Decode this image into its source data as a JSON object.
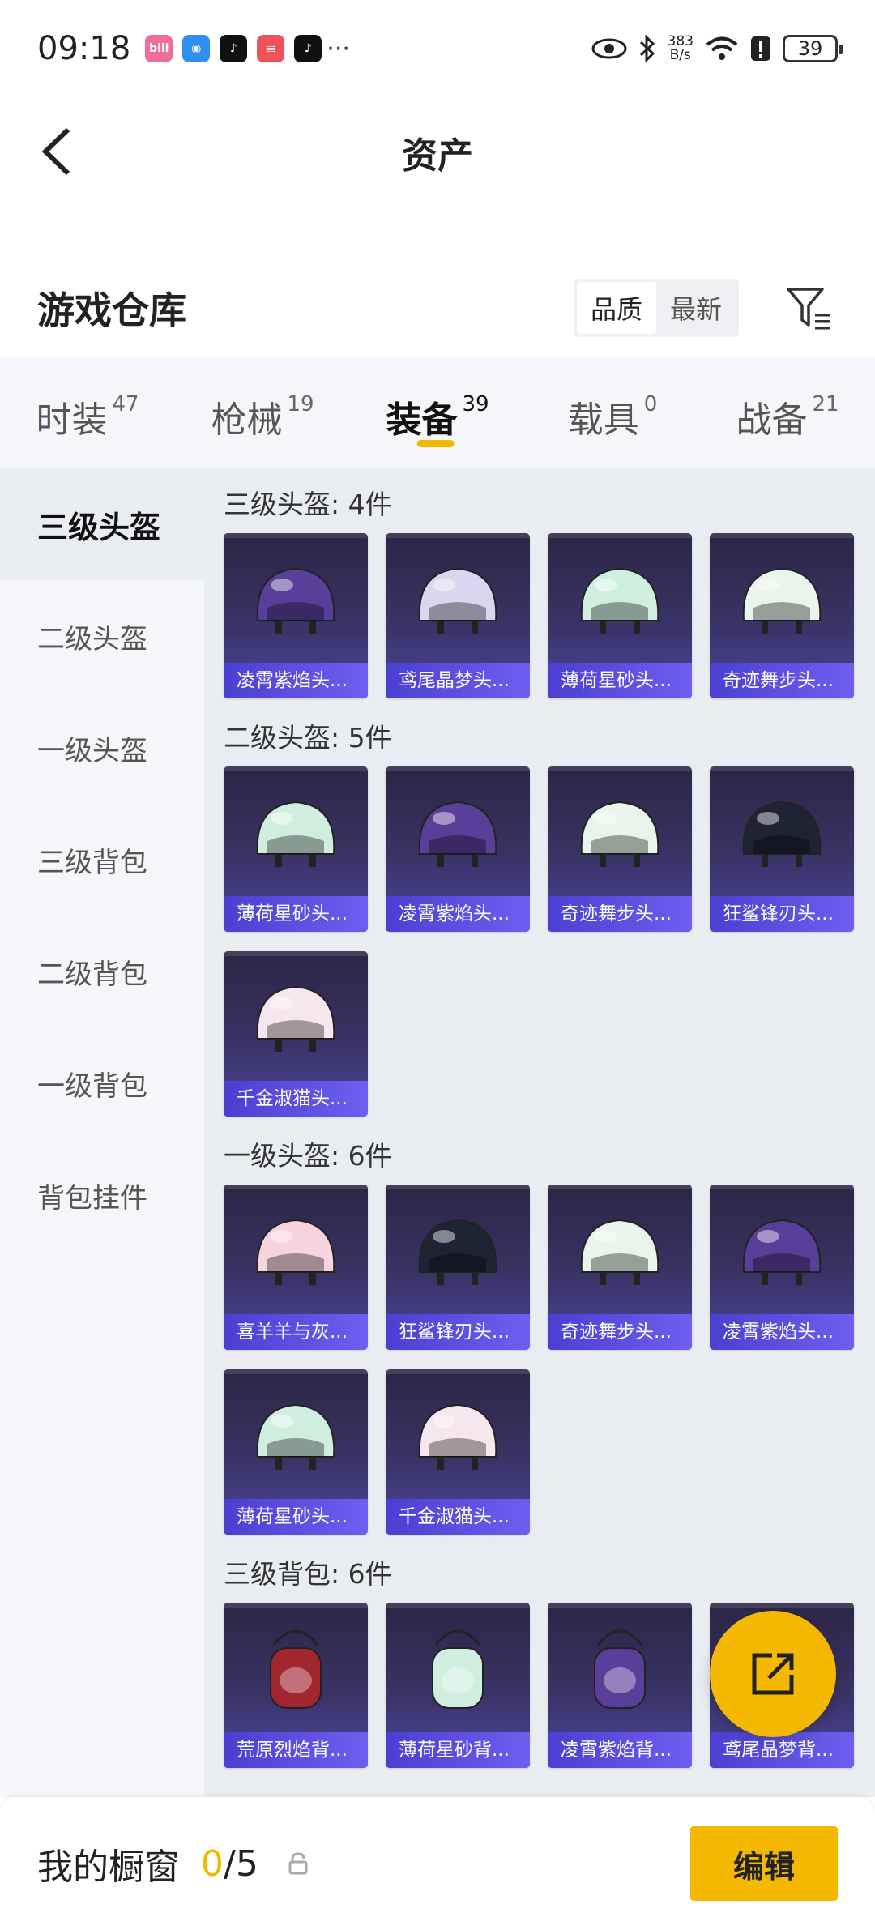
{
  "status_bar": {
    "time": "09:18",
    "apps": [
      {
        "name": "bilibili-icon",
        "glyph": "bili",
        "color": "#f06c9b"
      },
      {
        "name": "browser-icon",
        "glyph": "◉",
        "color": "#2f8ff0"
      },
      {
        "name": "tiktok-icon",
        "glyph": "♪",
        "color": "#111111"
      },
      {
        "name": "shopping-icon",
        "glyph": "▤",
        "color": "#f0525a"
      },
      {
        "name": "tiktok-icon-2",
        "glyph": "♪",
        "color": "#111111"
      }
    ],
    "more": "···",
    "net_speed_top": "383",
    "net_speed_bottom": "B/s",
    "battery": "39"
  },
  "nav": {
    "title": "资产"
  },
  "warehouse": {
    "title": "游戏仓库",
    "sort_options": [
      "品质",
      "最新"
    ],
    "sort_active": "品质"
  },
  "tabs": [
    {
      "label": "时装",
      "count": "47"
    },
    {
      "label": "枪械",
      "count": "19"
    },
    {
      "label": "装备",
      "count": "39",
      "active": true
    },
    {
      "label": "载具",
      "count": "0"
    },
    {
      "label": "战备",
      "count": "21"
    }
  ],
  "sidebar": {
    "items": [
      "三级头盔",
      "二级头盔",
      "一级头盔",
      "三级背包",
      "二级背包",
      "一级背包",
      "背包挂件"
    ],
    "active_index": 0
  },
  "sections": [
    {
      "title": "三级头盔: 4件",
      "items": [
        "凌霄紫焰头...",
        "鸢尾晶梦头...",
        "薄荷星砂头...",
        "奇迹舞步头..."
      ]
    },
    {
      "title": "二级头盔: 5件",
      "items": [
        "薄荷星砂头...",
        "凌霄紫焰头...",
        "奇迹舞步头...",
        "狂鲨锋刃头...",
        "千金淑猫头..."
      ]
    },
    {
      "title": "一级头盔: 6件",
      "items": [
        "喜羊羊与灰...",
        "狂鲨锋刃头...",
        "奇迹舞步头...",
        "凌霄紫焰头...",
        "薄荷星砂头...",
        "千金淑猫头..."
      ]
    },
    {
      "title": "三级背包: 6件",
      "items": [
        "荒原烈焰背...",
        "薄荷星砂背...",
        "凌霄紫焰背...",
        "鸢尾晶梦背..."
      ]
    }
  ],
  "item_colors": {
    "凌霄紫焰": "#5a3f9a",
    "鸢尾晶梦": "#d9d6f0",
    "薄荷星砂": "#cfeee0",
    "奇迹舞步": "#e8f4ec",
    "狂鲨锋刃": "#1e2433",
    "千金淑猫": "#f6e6ee",
    "喜羊羊与灰": "#f7d3de",
    "荒原烈焰": "#a12630"
  },
  "bottom": {
    "showcase_label": "我的橱窗",
    "used": "0",
    "total": "/5",
    "edit_label": "编辑"
  }
}
